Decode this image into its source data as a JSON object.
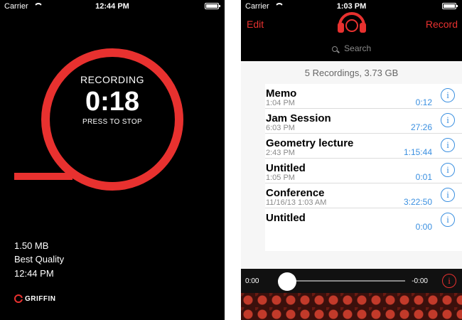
{
  "left": {
    "status": {
      "carrier": "Carrier",
      "time": "12:44 PM"
    },
    "recording": {
      "title": "RECORDING",
      "time": "0:18",
      "subtitle": "PRESS TO STOP"
    },
    "info": {
      "size": "1.50 MB",
      "quality": "Best Quality",
      "time": "12:44 PM"
    },
    "logo": "GRIFFIN",
    "colors": {
      "accent": "#e8312f",
      "background": "#000000"
    }
  },
  "right": {
    "status": {
      "carrier": "Carrier",
      "time": "1:03 PM"
    },
    "nav": {
      "edit": "Edit",
      "record": "Record",
      "search_placeholder": "Search"
    },
    "summary": "5 Recordings, 3.73 GB",
    "recordings": [
      {
        "name": "Memo",
        "date": "1:04 PM",
        "duration": "0:12"
      },
      {
        "name": "Jam Session",
        "date": "6:03 PM",
        "duration": "27:26"
      },
      {
        "name": "Geometry lecture",
        "date": "2:43 PM",
        "duration": "1:15:44"
      },
      {
        "name": "Untitled",
        "date": "1:05 PM",
        "duration": "0:01"
      },
      {
        "name": "Conference",
        "date": "11/16/13 1:03 AM",
        "duration": "3:22:50"
      },
      {
        "name": "Untitled",
        "date": "",
        "duration": "0:00"
      }
    ],
    "player": {
      "start": "0:00",
      "end": "-0:00"
    },
    "colors": {
      "accent": "#e8312f",
      "link": "#3a8fe0"
    }
  }
}
